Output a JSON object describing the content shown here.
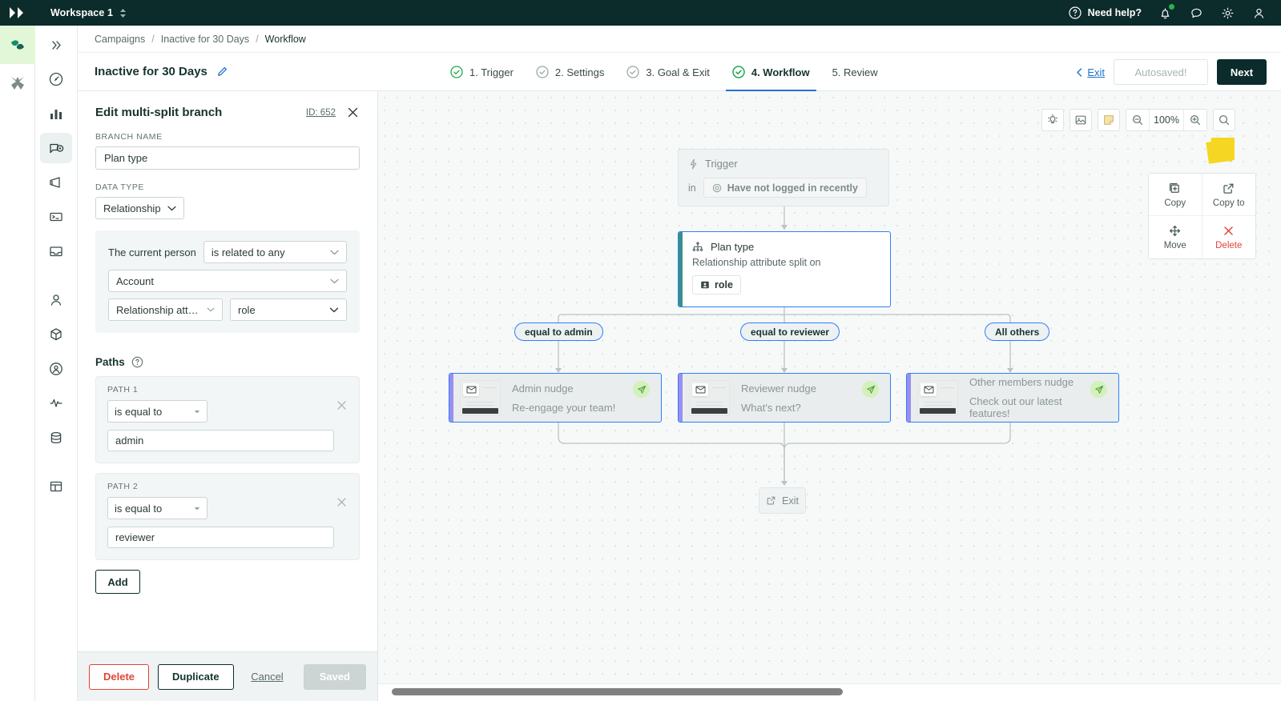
{
  "topbar": {
    "workspace": "Workspace 1",
    "need_help": "Need help?",
    "icons": [
      "bell-icon",
      "chat-icon",
      "gear-icon",
      "user-icon"
    ]
  },
  "breadcrumb": {
    "items": [
      "Campaigns",
      "Inactive for 30 Days",
      "Workflow"
    ],
    "separator": "/"
  },
  "header": {
    "title": "Inactive for 30 Days",
    "exit_label": "Exit",
    "autosaved_label": "Autosaved!",
    "next_label": "Next",
    "steps": [
      {
        "label": "1. Trigger",
        "state": "complete"
      },
      {
        "label": "2. Settings",
        "state": "complete"
      },
      {
        "label": "3. Goal & Exit",
        "state": "complete"
      },
      {
        "label": "4. Workflow",
        "state": "current"
      },
      {
        "label": "5. Review",
        "state": "pending"
      }
    ]
  },
  "panel": {
    "title": "Edit multi-split branch",
    "id_label": "ID: 652",
    "branch_name_label": "BRANCH NAME",
    "branch_name_value": "Plan type",
    "data_type_label": "DATA TYPE",
    "data_type_value": "Relationship",
    "condition": {
      "subject": "The current person",
      "operator": "is related to any",
      "object": "Account",
      "attribute_type": "Relationship attri...",
      "attribute": "role"
    },
    "paths_heading": "Paths",
    "paths": [
      {
        "label": "PATH 1",
        "operator": "is equal to",
        "value": "admin"
      },
      {
        "label": "PATH 2",
        "operator": "is equal to",
        "value": "reviewer"
      }
    ],
    "add_label": "Add",
    "footer": {
      "delete": "Delete",
      "duplicate": "Duplicate",
      "cancel": "Cancel",
      "save": "Saved"
    }
  },
  "canvas": {
    "toolbar": {
      "zoom_value": "100%",
      "buttons": [
        "lightbulb-icon",
        "image-icon",
        "sticky-note-icon",
        "zoom-out-icon",
        "zoom-in-icon",
        "search-icon"
      ]
    },
    "context_menu": [
      {
        "label": "Copy",
        "icon": "copy-icon"
      },
      {
        "label": "Copy to",
        "icon": "external-link-icon"
      },
      {
        "label": "Move",
        "icon": "move-icon"
      },
      {
        "label": "Delete",
        "icon": "close-icon"
      }
    ],
    "trigger_node": {
      "title": "Trigger",
      "connector": "in",
      "segment": "Have not logged in recently"
    },
    "split_node": {
      "title": "Plan type",
      "subtitle": "Relationship attribute split on",
      "attribute": "role"
    },
    "branch_labels": [
      "equal to admin",
      "equal to reviewer",
      "All others"
    ],
    "message_nodes": [
      {
        "title": "Admin nudge",
        "subject": "Re-engage your team!"
      },
      {
        "title": "Reviewer nudge",
        "subject": "What's next?"
      },
      {
        "title": "Other members nudge",
        "subject": "Check out our latest features!"
      }
    ],
    "exit_node": {
      "label": "Exit"
    }
  },
  "colors": {
    "topbar_bg": "#0c2b2b",
    "accent_blue": "#2d7ff9",
    "selected_node_border": "#2d7ff9",
    "split_accent": "#3a8f8a",
    "message_accent": "#9b8ef0",
    "danger": "#e0453a",
    "success_green": "#27b34c",
    "sticky_yellow": "#f5d623",
    "canvas_bg": "#f7f9f9"
  }
}
